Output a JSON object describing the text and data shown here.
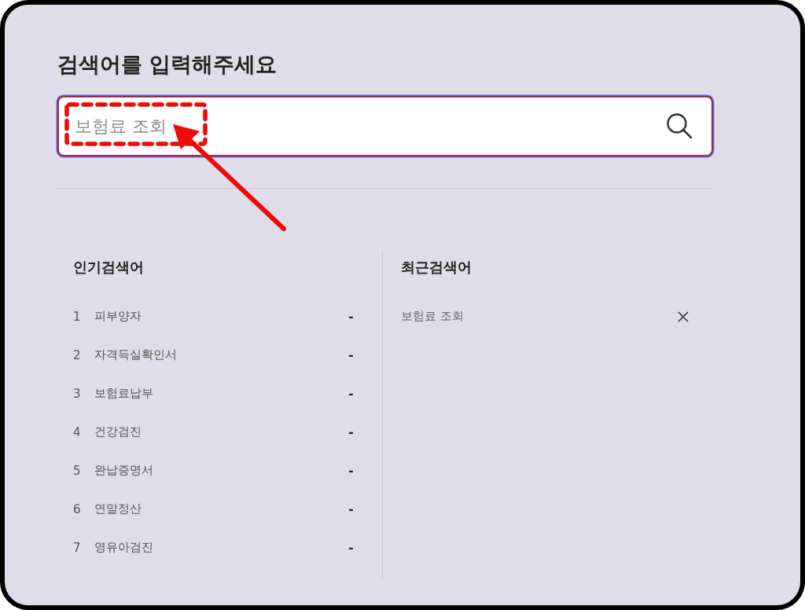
{
  "title": "검색어를 입력해주세요",
  "search": {
    "value": "보험료 조회"
  },
  "popular": {
    "heading": "인기검색어",
    "items": [
      {
        "rank": "1",
        "term": "피부양자",
        "change": "-"
      },
      {
        "rank": "2",
        "term": "자격득실확인서",
        "change": "-"
      },
      {
        "rank": "3",
        "term": "보험료납부",
        "change": "-"
      },
      {
        "rank": "4",
        "term": "건강검진",
        "change": "-"
      },
      {
        "rank": "5",
        "term": "완납증명서",
        "change": "-"
      },
      {
        "rank": "6",
        "term": "연말정산",
        "change": "-"
      },
      {
        "rank": "7",
        "term": "영유아검진",
        "change": "-"
      }
    ]
  },
  "recent": {
    "heading": "최근검색어",
    "items": [
      {
        "term": "보험료 조회"
      }
    ]
  },
  "annotations": [
    {
      "kind": "dashed-box"
    },
    {
      "kind": "arrow"
    }
  ]
}
